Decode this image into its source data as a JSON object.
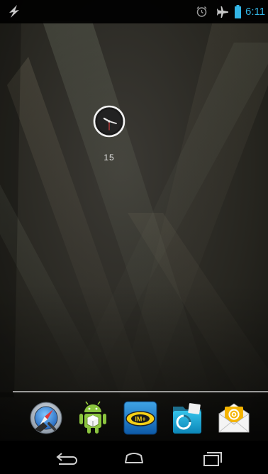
{
  "status_bar": {
    "left_icon": "flash-bolt-icon",
    "alarm_icon": "alarm-clock-icon",
    "airplane_icon": "airplane-mode-icon",
    "battery_icon": "battery-icon",
    "time": "6:11",
    "accent_color": "#33b5e5"
  },
  "clock_widget": {
    "icon": "analog-clock-icon",
    "date": "15"
  },
  "dock": {
    "apps": [
      {
        "icon": "safari-compass-app-icon"
      },
      {
        "icon": "android-package-app-icon"
      },
      {
        "icon": "im-plus-app-icon"
      },
      {
        "icon": "file-manager-app-icon"
      },
      {
        "icon": "email-app-icon"
      }
    ]
  },
  "nav_bar": {
    "back_icon": "back-icon",
    "home_icon": "home-icon",
    "recents_icon": "recent-apps-icon"
  }
}
